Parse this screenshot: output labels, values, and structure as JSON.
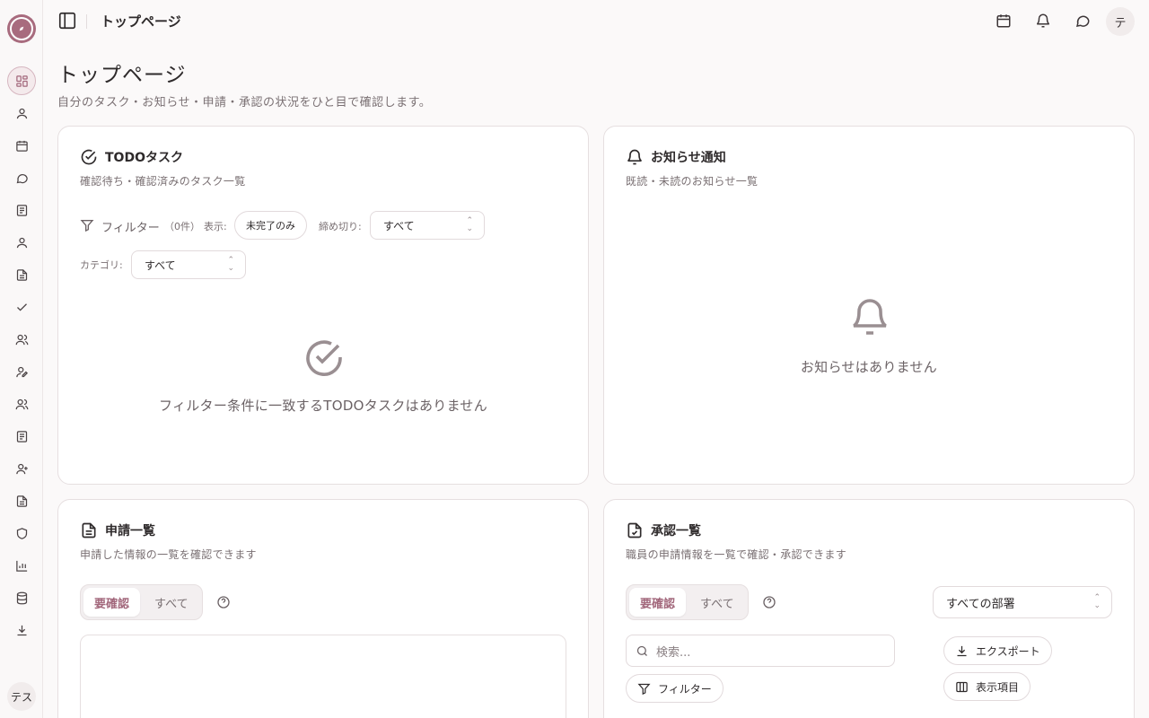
{
  "app": {
    "user_initial_top": "テ",
    "user_initial_bottom": "テス"
  },
  "header": {
    "title": "トップページ"
  },
  "page": {
    "title": "トップページ",
    "subtitle": "自分のタスク・お知らせ・申請・承認の状況をひと目で確認します。"
  },
  "todo": {
    "title": "TODOタスク",
    "subtitle": "確認待ち・確認済みのタスク一覧",
    "filter_label": "フィルター",
    "filter_count": "（0件）",
    "display_label": "表示:",
    "display_value": "未完了のみ",
    "deadline_label": "締め切り:",
    "deadline_value": "すべて",
    "category_label": "カテゴリ:",
    "category_value": "すべて",
    "empty": "フィルター条件に一致するTODOタスクはありません"
  },
  "notices": {
    "title": "お知らせ通知",
    "subtitle": "既読・未読のお知らせ一覧",
    "empty": "お知らせはありません"
  },
  "applications": {
    "title": "申請一覧",
    "subtitle": "申請した情報の一覧を確認できます",
    "tab_required": "要確認",
    "tab_all": "すべて"
  },
  "approvals": {
    "title": "承認一覧",
    "subtitle": "職員の申請情報を一覧で確認・承認できます",
    "tab_required": "要確認",
    "tab_all": "すべて",
    "department_value": "すべての部署",
    "search_placeholder": "検索...",
    "filter_button": "フィルター",
    "export_button": "エクスポート",
    "columns_button": "表示項目"
  },
  "colors": {
    "accent": "#a2677b",
    "background": "#fbf9f9",
    "border": "#e6dfe0"
  }
}
